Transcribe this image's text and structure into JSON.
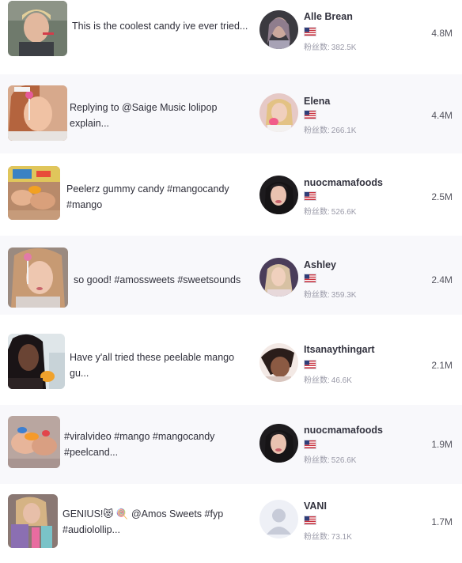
{
  "fans_label": "粉丝数:",
  "colors": {
    "alt_row_bg": "#f8f8fb",
    "name": "#33333f",
    "fans": "#9a9aa8"
  },
  "rows": [
    {
      "title": "This is the coolest candy ive ever tried...",
      "creator": "Alle Brean",
      "country_icon": "us-flag-icon",
      "fans": "382.5K",
      "views": "4.8M"
    },
    {
      "title": "Replying to @Saige Music lolipop explain...",
      "creator": "Elena",
      "country_icon": "us-flag-icon",
      "fans": "266.1K",
      "views": "4.4M"
    },
    {
      "title": "Peelerz gummy candy #mangocandy #mango",
      "creator": "nuocmamafoods",
      "country_icon": "us-flag-icon",
      "fans": "526.6K",
      "views": "2.5M"
    },
    {
      "title": "so good! #amossweets #sweetsounds",
      "creator": "Ashley",
      "country_icon": "us-flag-icon",
      "fans": "359.3K",
      "views": "2.4M"
    },
    {
      "title": "Have y'all tried these peelable mango gu...",
      "creator": "Itsanaythingart",
      "country_icon": "us-flag-icon",
      "fans": "46.6K",
      "views": "2.1M"
    },
    {
      "title": "#viralvideo #mango #mangocandy #peelcand...",
      "creator": "nuocmamafoods",
      "country_icon": "us-flag-icon",
      "fans": "526.6K",
      "views": "1.9M"
    },
    {
      "title": "GENIUS!😻 🍭 @Amos Sweets #fyp #audiolollip...",
      "creator": "VANI",
      "country_icon": "us-flag-icon",
      "fans": "73.1K",
      "views": "1.7M"
    }
  ]
}
